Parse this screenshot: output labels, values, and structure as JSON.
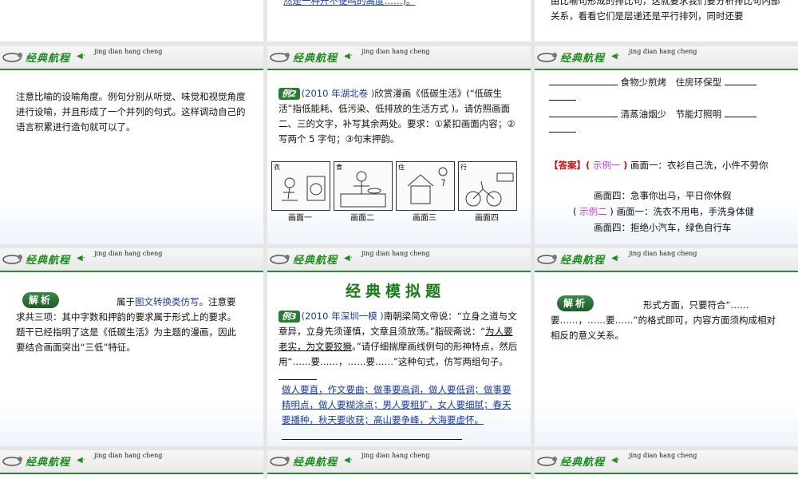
{
  "banner": {
    "title": "经典航程",
    "pinyin": "jing dian hang cheng"
  },
  "slides": {
    "s1_text": "注意比喻的设喻角度。例句分别从听觉、味觉和视觉角度进行设喻，并且形成了一个并列的句式。这样调动自己的语言积累进行造句就可以了。",
    "s2_example_badge": "例2",
    "s2_example_source": "(2010 年湖北卷 )",
    "s2_example_body": "欣赏漫画《低碳生活》(“低碳生活”指低能耗、低污染、低排放的生活方式 )。请仿照画面二、三的文字，补写其余两处。要求：①紧扣画面内容；②写两个 5 字句；③句末押韵。",
    "s2_panels": [
      "画面一",
      "画面二",
      "画面三",
      "画面四"
    ],
    "s2_panel_tags": [
      "衣",
      "食",
      "住",
      "行"
    ],
    "s3_line1": "食物少煎烤　住房环保型",
    "s3_line2": "清蒸油烟少　节能灯照明",
    "s3_answer_label": "【答案】",
    "s3_ex1_label": "示例一",
    "s3_ex1_a": "画面一：衣衫自己洗，小件不劳你",
    "s3_ex1_b": "画面四：急事你出马，平日你休假",
    "s3_ex2_label": "示例二",
    "s3_ex2_a": "画面一：洗衣不用电，手洗身体健",
    "s3_ex2_b": "画面四：拒绝小汽车，绿色自行车",
    "s4_jiexi": "解析",
    "s4_text_a": "属于",
    "s4_text_link": "图文转换类仿写",
    "s4_text_b": "。注意要求共三项：其中字数和押韵的要求属于形式上的要求。题干已经指明了这是《低碳生活》为主题的漫画，因此要结合画面突出“三低”特征。",
    "s5_heading": "经典模拟题",
    "s5_badge": "例3",
    "s5_source": "(2010 年深圳一模 )",
    "s5_body_a": "南朝梁简文帝说：“立身之道与文章异，立身先须谨慎，文章且须放荡。”脂砚斋说：“",
    "s5_body_quote": "为人要老实，为文要狡猾",
    "s5_body_b": "。”请仔细揣摩画线例句的形神特点，然后用“……要……，……要……”这种句式，仿写两组句子。",
    "s5_answer": "做人要直，作文要曲；做事要高调，做人要低调；做事要精明点，做人要糊涂点；男人要粗犷，女人要细腻；春天要播种，秋天要收获；高山要争峰，大海要虚怀。",
    "s6_jiexi": "解析",
    "s6_text": "形式方面，只要符合“……要……，……要……”的格式即可，内容方面须构成相对相反的意义关系。",
    "top_mid_text": "然是一种升不便鸣的高度……)。",
    "top_right_text": "由比喻句形成的排比句，这就要求我们要分析排比句内部关系，看看它们是层递还是平行排列，同时还要"
  },
  "colors": {
    "banner_green": "#1e8c1e",
    "link_blue": "#1b3aa0",
    "example_pink": "#d13bd1",
    "answer_red": "#cc1111"
  }
}
